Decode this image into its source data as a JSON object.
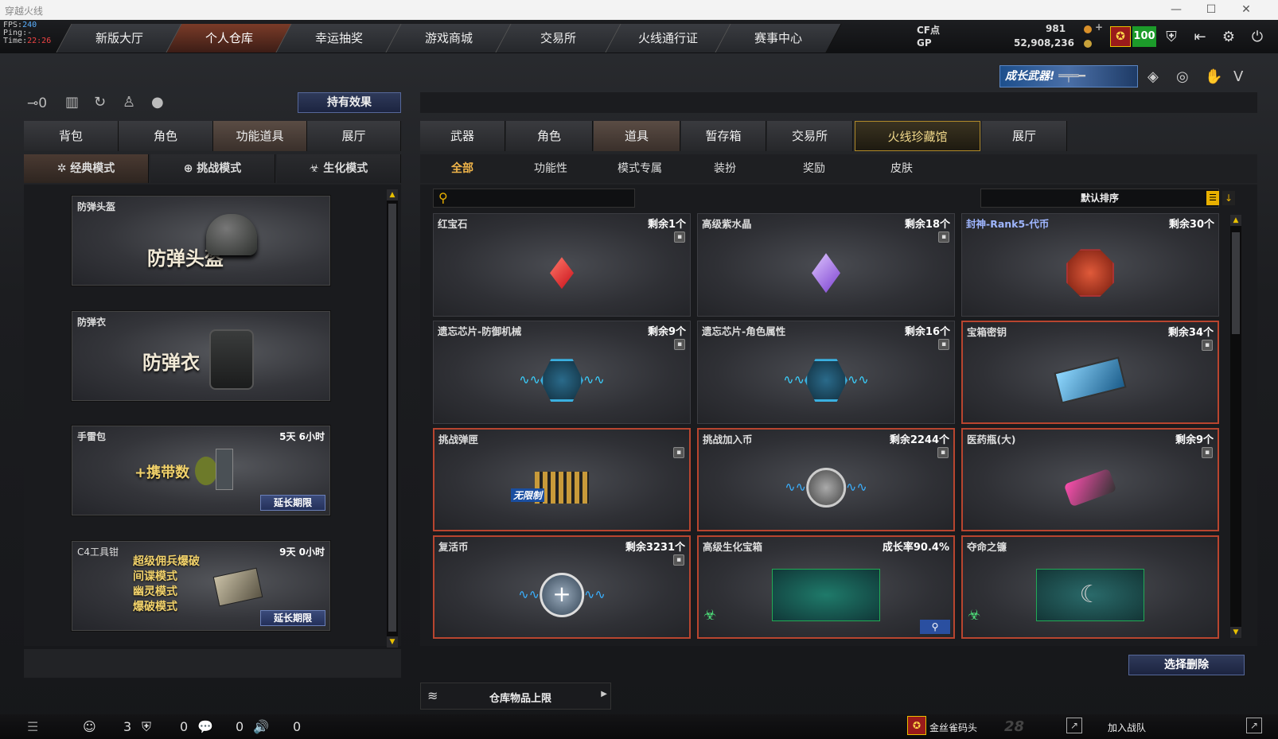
{
  "window": {
    "title": "穿越火线"
  },
  "perf": {
    "fps_label": "FPS:",
    "fps": "240",
    "ping_label": "Ping:",
    "ping": "-",
    "time_label": "Time:",
    "time": "22:26"
  },
  "nav": {
    "tabs": [
      "新版大厅",
      "个人仓库",
      "幸运抽奖",
      "游戏商城",
      "交易所",
      "火线通行证",
      "赛事中心"
    ],
    "active": 1
  },
  "currency": {
    "cf_label": "CF点",
    "cf_value": "981",
    "gp_label": "GP",
    "gp_value": "52,908,236",
    "level": "100"
  },
  "banner": {
    "text": "成长武器!"
  },
  "left": {
    "effect_button": "持有效果",
    "tabs": [
      "背包",
      "角色",
      "功能道具",
      "展厅"
    ],
    "tab_active": 2,
    "modes": [
      "经典模式",
      "挑战模式",
      "生化模式"
    ],
    "items": [
      {
        "name": "防弹头盔",
        "big": "防弹头盔",
        "time": "",
        "extend": ""
      },
      {
        "name": "防弹衣",
        "big": "防弹衣",
        "time": "",
        "extend": ""
      },
      {
        "name": "手雷包",
        "big": "+携带数",
        "time": "5天 6小时",
        "extend": "延长期限"
      },
      {
        "name": "C4工具钳",
        "big_lines": [
          "超级佣兵爆破",
          "间谍模式",
          "幽灵模式",
          "爆破模式"
        ],
        "time": "9天 0小时",
        "extend": "延长期限"
      }
    ]
  },
  "right": {
    "tabs": [
      "武器",
      "角色",
      "道具",
      "暂存箱",
      "交易所",
      "火线珍藏馆",
      "展厅"
    ],
    "tab_active": 2,
    "subtabs": [
      "全部",
      "功能性",
      "模式专属",
      "装扮",
      "奖励",
      "皮肤"
    ],
    "subtab_active": 0,
    "search": {
      "placeholder": ""
    },
    "sort": "默认排序",
    "items": [
      {
        "name": "红宝石",
        "remain": "剩余1个",
        "icon": "ruby-icon",
        "red": false
      },
      {
        "name": "高级紫水晶",
        "remain": "剩余18个",
        "icon": "amethyst-icon",
        "red": false
      },
      {
        "name": "封神-Rank5-代币",
        "remain": "剩余30个",
        "icon": "token-icon",
        "red": false
      },
      {
        "name": "遗忘芯片-防御机械",
        "remain": "剩余9个",
        "icon": "chip-icon",
        "red": false
      },
      {
        "name": "遗忘芯片-角色属性",
        "remain": "剩余16个",
        "icon": "chip-icon",
        "red": false
      },
      {
        "name": "宝箱密钥",
        "remain": "剩余34个",
        "icon": "key-card-icon",
        "red": true
      },
      {
        "name": "挑战弹匣",
        "remain": "",
        "icon": "magazine-icon",
        "red": true,
        "label": "无限制"
      },
      {
        "name": "挑战加入币",
        "remain": "剩余2244个",
        "icon": "join-coin-icon",
        "red": true
      },
      {
        "name": "医药瓶(大)",
        "remain": "剩余9个",
        "icon": "medkit-icon",
        "red": true
      },
      {
        "name": "复活币",
        "remain": "剩余3231个",
        "icon": "revive-coin-icon",
        "red": true
      },
      {
        "name": "高级生化宝箱",
        "remain": "成长率90.4%",
        "icon": "bio-box-icon",
        "red": true
      },
      {
        "name": "夺命之镰",
        "remain": "",
        "icon": "scythe-icon",
        "red": true
      }
    ],
    "delete_button": "选择删除",
    "storage_limit": "仓库物品上限"
  },
  "status": {
    "friends": "3",
    "shield": "0",
    "chat": "0",
    "voice": "0",
    "clan_name": "金丝雀码头",
    "clan_level": "28",
    "join_team": "加入战队"
  },
  "colors": {
    "accent_red": "#b8452f",
    "active_tab": "#7a3b28",
    "level_green": "#1c9b2a"
  }
}
